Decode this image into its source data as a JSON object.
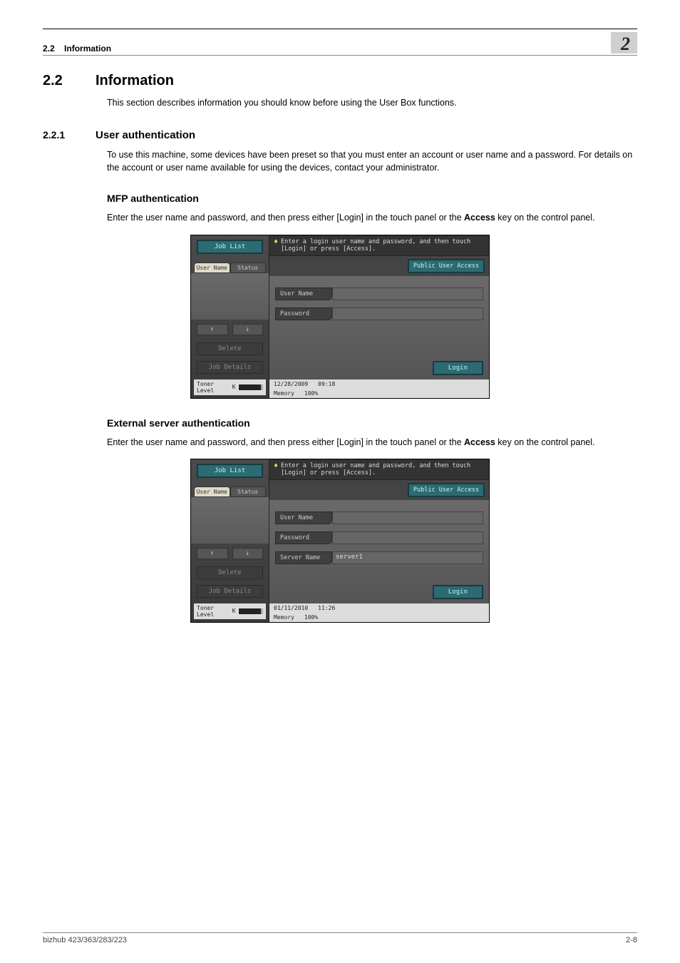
{
  "header": {
    "section_label": "2.2",
    "section_title": "Information",
    "chapter_number": "2"
  },
  "h1": {
    "num": "2.2",
    "title": "Information"
  },
  "intro": "This section describes information you should know before using the User Box functions.",
  "sub1": {
    "num": "2.2.1",
    "title": "User authentication",
    "body": "To use this machine, some devices have been preset so that you must enter an account or user name and a password. For details on the account or user name available for using the devices, contact your administrator."
  },
  "mfp_h": "MFP authentication",
  "mfp_body_a": "Enter the user name and password, and then press either [Login] in the touch panel or the ",
  "mfp_body_b": "Access",
  "mfp_body_c": " key on the control panel.",
  "ext_h": "External server authentication",
  "panel": {
    "job_list": "Job List",
    "instruction": "Enter a login user name and password, and then touch [Login] or press [Access].",
    "public": "Public User Access",
    "tab_user": "User\nName",
    "tab_status": "Status",
    "user_name": "User Name",
    "password": "Password",
    "server_name": "Server Name",
    "server_val": "server1",
    "delete": "Delete",
    "job_details": "Job Details",
    "login": "Login",
    "toner": "Toner Level",
    "k": "K",
    "date1": "12/28/2009",
    "time1": "09:18",
    "date2": "01/11/2010",
    "time2": "11:26",
    "mem": "Memory",
    "memval": "100%",
    "up": "↑",
    "down": "↓"
  },
  "footer": {
    "left": "bizhub 423/363/283/223",
    "right": "2-8"
  }
}
